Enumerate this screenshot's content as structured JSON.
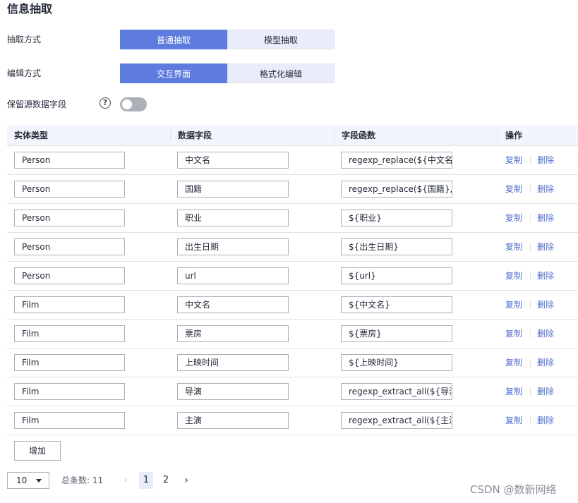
{
  "page": {
    "title": "信息抽取"
  },
  "form": {
    "extract_mode": {
      "label": "抽取方式",
      "options": [
        "普通抽取",
        "模型抽取"
      ],
      "selected": "普通抽取"
    },
    "edit_mode": {
      "label": "编辑方式",
      "options": [
        "交互界面",
        "格式化编辑"
      ],
      "selected": "交互界面"
    },
    "keep_source": {
      "label": "保留源数据字段",
      "help_icon": "question-circle-icon",
      "enabled": false
    }
  },
  "table": {
    "headers": [
      "实体类型",
      "数据字段",
      "字段函数",
      "操作"
    ],
    "rows": [
      {
        "entity": "Person",
        "field": "中文名",
        "func": "regexp_replace(${中文名},",
        "copy": "复制",
        "delete": "删除"
      },
      {
        "entity": "Person",
        "field": "国籍",
        "func": "regexp_replace(${国籍}, '",
        "copy": "复制",
        "delete": "删除"
      },
      {
        "entity": "Person",
        "field": "职业",
        "func": "${职业}",
        "copy": "复制",
        "delete": "删除"
      },
      {
        "entity": "Person",
        "field": "出生日期",
        "func": "${出生日期}",
        "copy": "复制",
        "delete": "删除"
      },
      {
        "entity": "Person",
        "field": "url",
        "func": "${url}",
        "copy": "复制",
        "delete": "删除"
      },
      {
        "entity": "Film",
        "field": "中文名",
        "func": "${中文名}",
        "copy": "复制",
        "delete": "删除"
      },
      {
        "entity": "Film",
        "field": "票房",
        "func": "${票房}",
        "copy": "复制",
        "delete": "删除"
      },
      {
        "entity": "Film",
        "field": "上映时间",
        "func": "${上映时间}",
        "copy": "复制",
        "delete": "删除"
      },
      {
        "entity": "Film",
        "field": "导演",
        "func": "regexp_extract_all(${导演",
        "copy": "复制",
        "delete": "删除"
      },
      {
        "entity": "Film",
        "field": "主演",
        "func": "regexp_extract_all(${主演",
        "copy": "复制",
        "delete": "删除"
      }
    ],
    "add_label": "增加"
  },
  "pagination": {
    "page_size": "10",
    "total_label": "总条数: 11",
    "pages": [
      "1",
      "2"
    ],
    "current_page": "1",
    "prev_icon": "chevron-left-icon",
    "next_icon": "chevron-right-icon"
  },
  "watermark": "CSDN @数新网络"
}
